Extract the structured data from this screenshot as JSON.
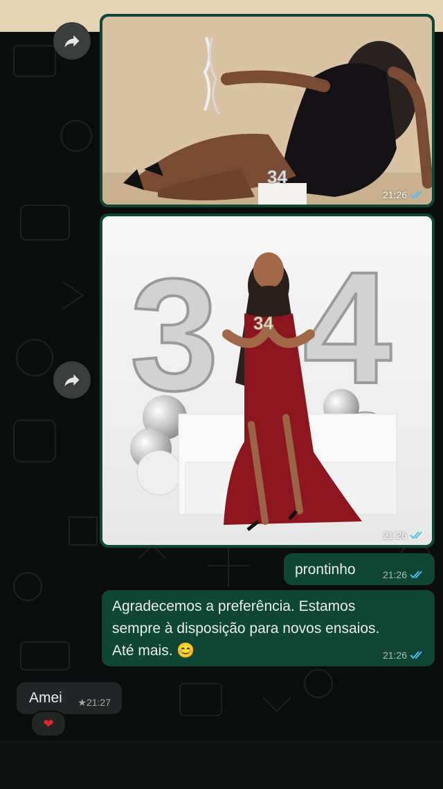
{
  "chat": {
    "messages": [
      {
        "type": "image",
        "direction": "outgoing",
        "time": "21:26",
        "status": "read",
        "alt": "Foto 1"
      },
      {
        "type": "image",
        "direction": "outgoing",
        "time": "21:26",
        "status": "read",
        "alt": "Foto 2"
      },
      {
        "type": "text",
        "direction": "outgoing",
        "text": "prontinho",
        "time": "21:26",
        "status": "read"
      },
      {
        "type": "text",
        "direction": "outgoing",
        "text_lines": [
          "Agradecemos a preferência. Estamos",
          "sempre à disposição para novos ensaios.",
          "Até mais. 😊"
        ],
        "time": "21:26",
        "status": "read"
      },
      {
        "type": "text",
        "direction": "incoming",
        "text": "Amei",
        "time": "★21:27",
        "reaction": "❤"
      }
    ]
  },
  "photo2": {
    "cake_number": "34"
  },
  "icons": {
    "forward": "forward-arrow-icon",
    "read": "double-check-icon"
  },
  "colors": {
    "outgoing_bubble": "#0f4634",
    "incoming_bubble": "#232626",
    "read_ticks": "#53bdeb",
    "background": "#0b0d0c"
  }
}
